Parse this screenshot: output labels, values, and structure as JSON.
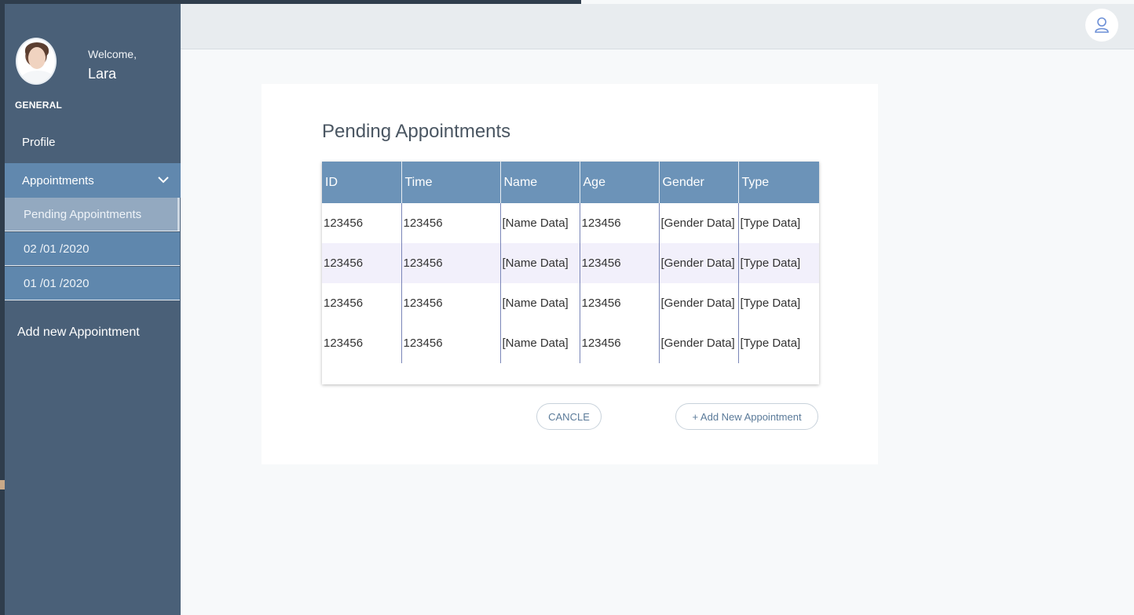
{
  "sidebar": {
    "welcome": "Welcome,",
    "username": "Lara",
    "section_label": "GENERAL",
    "profile_label": "Profile",
    "appointments_label": "Appointments",
    "sub_items": [
      {
        "label": "Pending Appointments",
        "active": true
      },
      {
        "label": "02 /01 /2020",
        "active": false
      },
      {
        "label": "01 /01 /2020",
        "active": false
      }
    ],
    "add_label": "Add new Appointment"
  },
  "header": {
    "user_icon": "user-icon"
  },
  "main": {
    "title": "Pending Appointments",
    "table": {
      "columns": [
        "ID",
        "Time",
        "Name",
        "Age",
        "Gender",
        "Type"
      ],
      "rows": [
        [
          "123456",
          "123456",
          "[Name Data]",
          "123456",
          "[Gender Data]",
          "[Type Data]"
        ],
        [
          "123456",
          "123456",
          "[Name Data]",
          "123456",
          "[Gender Data]",
          "[Type Data]"
        ],
        [
          "123456",
          "123456",
          "[Name Data]",
          "123456",
          "[Gender Data]",
          "[Type Data]"
        ],
        [
          "123456",
          "123456",
          "[Name Data]",
          "123456",
          "[Gender Data]",
          "[Type Data]"
        ]
      ]
    },
    "cancel_label": "CANCLE",
    "add_label": "+ Add New Appointment"
  },
  "colors": {
    "sidebar_bg": "#4a6078",
    "nav_active": "#6188ae",
    "table_header": "#6c93b8",
    "row_alt": "#f2f0fb"
  }
}
